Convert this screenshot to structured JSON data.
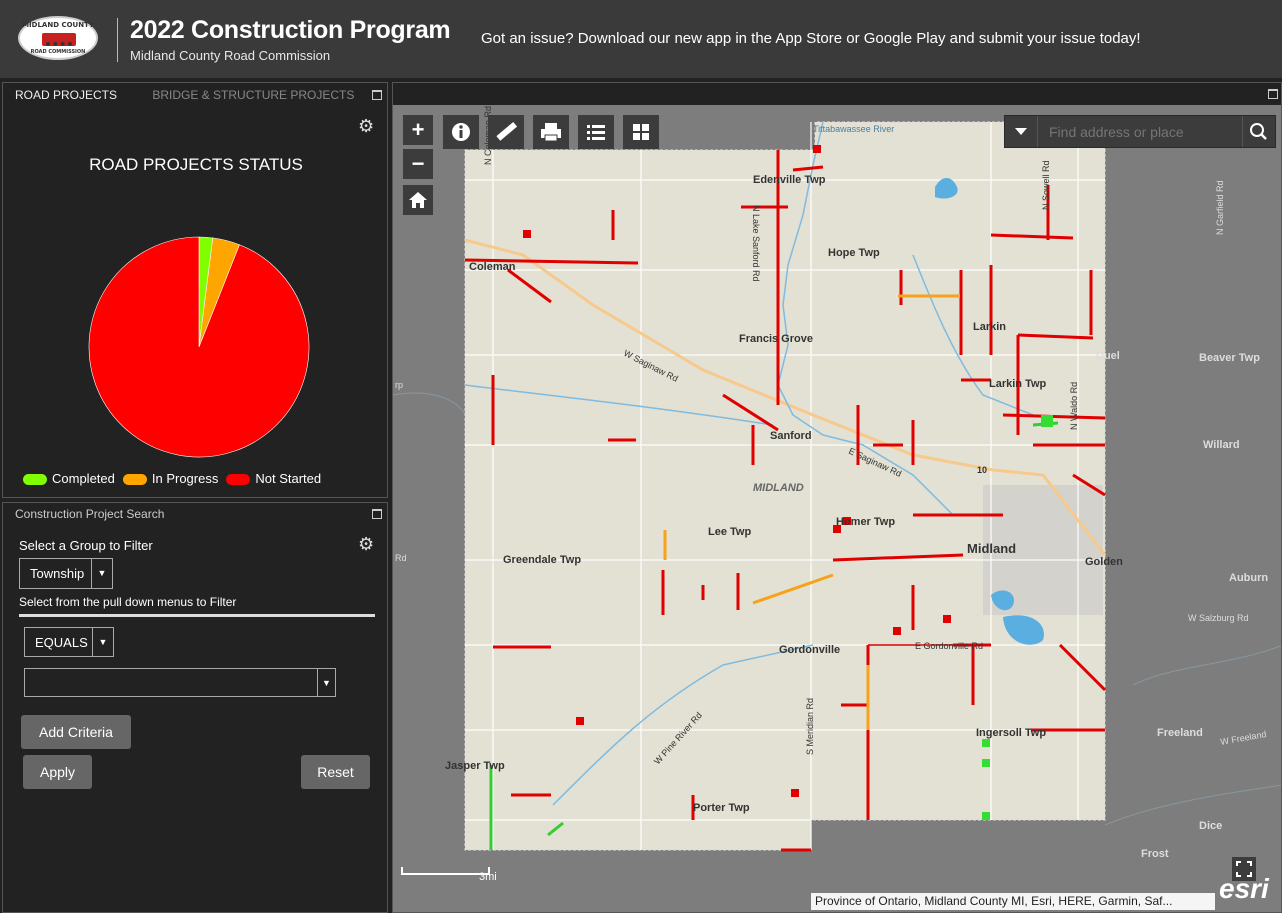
{
  "header": {
    "logo_ring_top": "MIDLAND COUNTY",
    "logo_ring_bottom": "ROAD COMMISSION",
    "title": "2022 Construction Program",
    "subtitle": "Midland County Road Commission",
    "banner": "Got an issue? Download our new app in the App Store or Google Play and submit your issue today!"
  },
  "status_panel": {
    "tabs": [
      "ROAD PROJECTS",
      "BRIDGE & STRUCTURE PROJECTS"
    ],
    "active_tab": "ROAD PROJECTS",
    "chart_title": "ROAD PROJECTS STATUS"
  },
  "chart_data": {
    "type": "pie",
    "title": "ROAD PROJECTS STATUS",
    "legend_position": "bottom",
    "slices": [
      {
        "name": "Completed",
        "value": 2,
        "color": "#7FFF00"
      },
      {
        "name": "In Progress",
        "value": 4,
        "color": "#FFA500"
      },
      {
        "name": "Not Started",
        "value": 94,
        "color": "#FF0000"
      }
    ]
  },
  "search_panel": {
    "title": "Construction Project Search",
    "group_label": "Select a Group to Filter",
    "group_value": "Township",
    "hint": "Select from the pull down menus to Filter",
    "operator_value": "EQUALS",
    "value_field": "",
    "add_criteria_label": "Add Criteria",
    "apply_label": "Apply",
    "reset_label": "Reset"
  },
  "map": {
    "zoom_in": "+",
    "zoom_out": "−",
    "search_placeholder": "Find address or place",
    "scale_label": "3mi",
    "attribution": "Province of Ontario, Midland County MI, Esri, HERE, Garmin, Saf...",
    "esri_label": "esri",
    "labels": [
      {
        "text": "Tittabawassee River"
      },
      {
        "text": "Edenville Twp"
      },
      {
        "text": "N Lake Sanford Rd"
      },
      {
        "text": "Hope Twp"
      },
      {
        "text": "Coleman"
      },
      {
        "text": "N Coleman Rd"
      },
      {
        "text": "Francis Grove"
      },
      {
        "text": "Larkin"
      },
      {
        "text": "Larkin Twp"
      },
      {
        "text": "Duel"
      },
      {
        "text": "Beaver Twp"
      },
      {
        "text": "W Saginaw Rd"
      },
      {
        "text": "Sanford"
      },
      {
        "text": "Willard"
      },
      {
        "text": "N Waldo Rd"
      },
      {
        "text": "E Saginaw Rd"
      },
      {
        "text": "MIDLAND"
      },
      {
        "text": "10"
      },
      {
        "text": "Lee Twp"
      },
      {
        "text": "Homer Twp"
      },
      {
        "text": "Midland"
      },
      {
        "text": "Greendale Twp"
      },
      {
        "text": "Golden"
      },
      {
        "text": "Auburn"
      },
      {
        "text": "W Salzburg Rd"
      },
      {
        "text": "Gordonville"
      },
      {
        "text": "E Gordonville Rd"
      },
      {
        "text": "S Meridian Rd"
      },
      {
        "text": "W Pine River Rd"
      },
      {
        "text": "Ingersoll Twp"
      },
      {
        "text": "Freeland"
      },
      {
        "text": "W Freeland"
      },
      {
        "text": "Jasper Twp"
      },
      {
        "text": "Porter Twp"
      },
      {
        "text": "Dice"
      },
      {
        "text": "Frost"
      },
      {
        "text": "N Garfield Rd"
      },
      {
        "text": "N Sowell Rd"
      },
      {
        "text": "Rd"
      },
      {
        "text": "rp"
      }
    ]
  }
}
